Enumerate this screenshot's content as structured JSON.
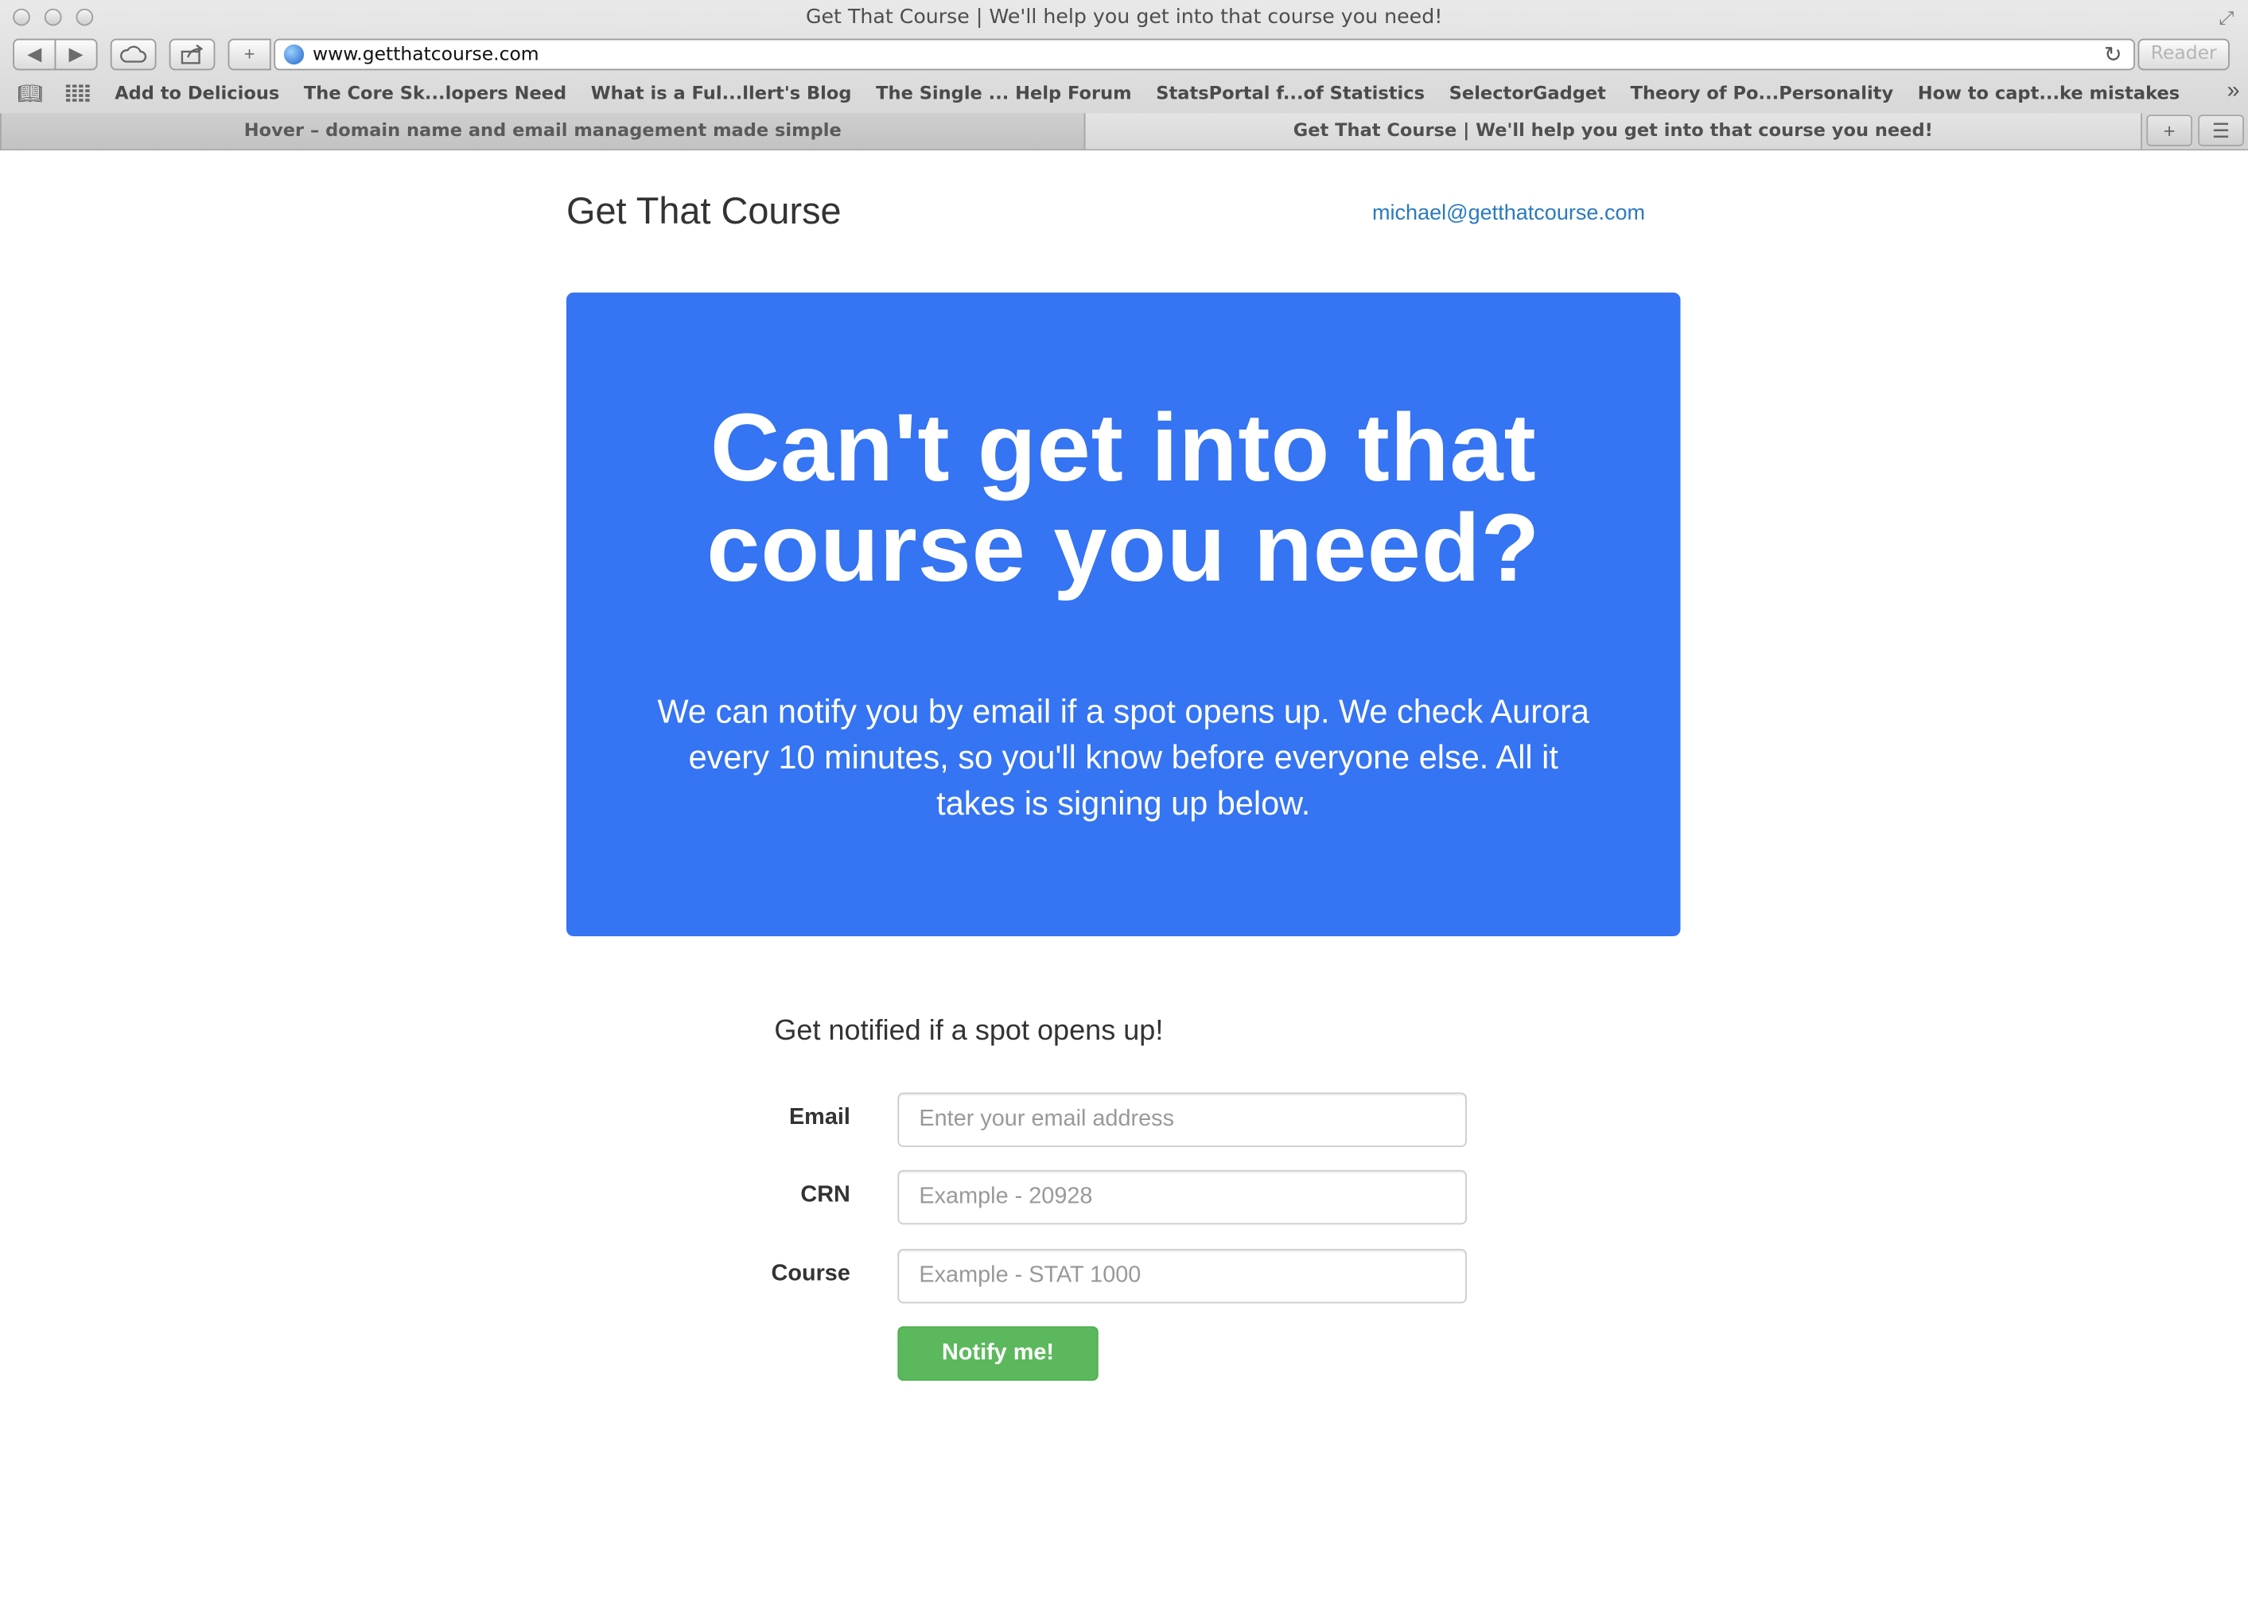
{
  "window": {
    "title": "Get That Course | We'll help you get into that course you need!"
  },
  "toolbar": {
    "back_icon": "◀",
    "forward_icon": "▶",
    "icloud_icon": "cloud-icon",
    "share_icon": "share-icon",
    "new_tab_symbol": "+",
    "url": "www.getthatcourse.com",
    "reload_icon": "↻",
    "reader_label": "Reader"
  },
  "bookmarks": {
    "items": [
      "Add to Delicious",
      "The Core Sk...lopers Need",
      "What is a Ful...llert's Blog",
      "The Single ... Help Forum",
      "StatsPortal f...of Statistics",
      "SelectorGadget",
      "Theory of Po...Personality",
      "How to capt...ke mistakes"
    ],
    "more_symbol": "»"
  },
  "tabs": [
    {
      "label": "Hover – domain name and email management made simple",
      "active": false
    },
    {
      "label": "Get That Course | We'll help you get into that course you need!",
      "active": true
    }
  ],
  "tab_controls": {
    "new_tab": "+",
    "tab_list": "☰"
  },
  "site": {
    "brand": "Get That Course",
    "account_email": "michael@getthatcourse.com"
  },
  "hero": {
    "title_line1": "Can't get into that",
    "title_line2": "course you need?",
    "text": "We can notify you by email if a spot opens up. We check Aurora every 10 minutes, so you'll know before everyone else. All it takes is signing up below.",
    "background": "#3574f2"
  },
  "form": {
    "title": "Get notified if a spot opens up!",
    "email_label": "Email",
    "email_placeholder": "Enter your email address",
    "email_value": "",
    "crn_label": "CRN",
    "crn_placeholder": "Example - 20928",
    "crn_value": "",
    "course_label": "Course",
    "course_placeholder": "Example - STAT 1000",
    "course_value": "",
    "submit_label": "Notify me!",
    "submit_color": "#5cb85c"
  }
}
